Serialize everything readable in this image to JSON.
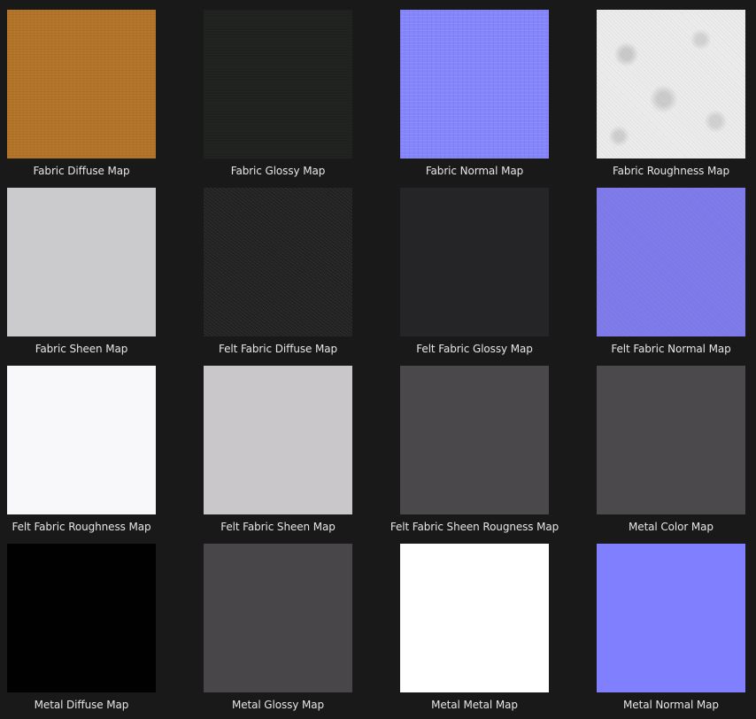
{
  "maps": [
    {
      "label": "Fabric Diffuse Map",
      "color": "#b37428"
    },
    {
      "label": "Fabric Glossy Map",
      "color": "#1f211f"
    },
    {
      "label": "Fabric Normal Map",
      "color": "#8484fb"
    },
    {
      "label": "Fabric Roughness Map",
      "color": "#ececec"
    },
    {
      "label": "Fabric Sheen Map",
      "color": "#cbcacc"
    },
    {
      "label": "Felt Fabric Diffuse Map",
      "color": "#262626"
    },
    {
      "label": "Felt Fabric Glossy Map",
      "color": "#252427"
    },
    {
      "label": "Felt Fabric Normal Map",
      "color": "#7d79e8"
    },
    {
      "label": "Felt Fabric Roughness Map",
      "color": "#f8f7fa"
    },
    {
      "label": "Felt Fabric Sheen Map",
      "color": "#c9c7ca"
    },
    {
      "label": "Felt Fabric Sheen Rougness Map",
      "color": "#4a484b"
    },
    {
      "label": "Metal Color Map",
      "color": "#4b494c"
    },
    {
      "label": "Metal Diffuse Map",
      "color": "#020102"
    },
    {
      "label": "Metal Glossy Map",
      "color": "#484649"
    },
    {
      "label": "Metal Metal Map",
      "color": "#ffffff"
    },
    {
      "label": "Metal Normal Map",
      "color": "#8080fe"
    }
  ]
}
